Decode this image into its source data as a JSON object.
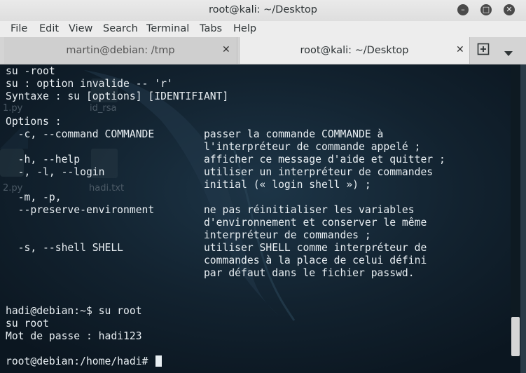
{
  "window": {
    "title": "root@kali: ~/Desktop"
  },
  "menu": [
    "File",
    "Edit",
    "View",
    "Search",
    "Terminal",
    "Tabs",
    "Help"
  ],
  "tabs": [
    {
      "label": "martin@debian: /tmp",
      "active": false
    },
    {
      "label": "root@kali: ~/Desktop",
      "active": true
    }
  ],
  "desktop_icons": [
    "1.py",
    "id_rsa",
    "2.py",
    "hadi.txt"
  ],
  "terminal": {
    "lines": [
      "su -root",
      "su : option invalide -- 'r'",
      "Syntaxe : su [options] [IDENTIFIANT]",
      "",
      "Options :",
      "  -c, --command COMMANDE        passer la commande COMMANDE à",
      "                                l'interpréteur de commande appelé ;",
      "  -h, --help                    afficher ce message d'aide et quitter ;",
      "  -, -l, --login                utiliser un interpréteur de commandes",
      "                                initial (« login shell ») ;",
      "  -m, -p,",
      "  --preserve-environment        ne pas réinitialiser les variables",
      "                                d'environnement et conserver le même",
      "                                interpréteur de commandes ;",
      "  -s, --shell SHELL             utiliser SHELL comme interpréteur de",
      "                                commandes à la place de celui défini",
      "                                par défaut dans le fichier passwd.",
      "",
      "",
      "hadi@debian:~$ su root",
      "su root",
      "Mot de passe : hadi123",
      "",
      "root@debian:/home/hadi# "
    ],
    "colors": {
      "text": "#e8eef2",
      "background": "#12222f"
    }
  }
}
